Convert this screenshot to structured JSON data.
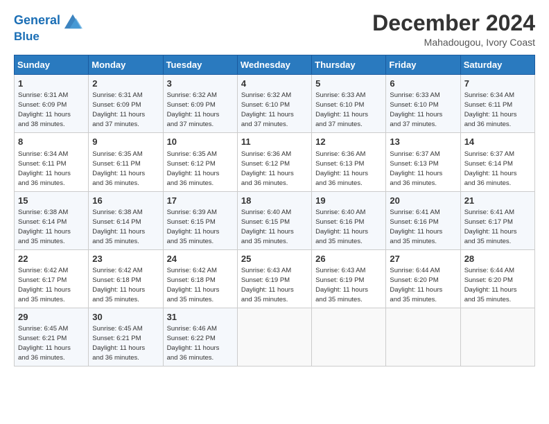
{
  "header": {
    "logo_line1": "General",
    "logo_line2": "Blue",
    "month_year": "December 2024",
    "location": "Mahadougou, Ivory Coast"
  },
  "days_of_week": [
    "Sunday",
    "Monday",
    "Tuesday",
    "Wednesday",
    "Thursday",
    "Friday",
    "Saturday"
  ],
  "weeks": [
    [
      {
        "day": "1",
        "sunrise": "6:31 AM",
        "sunset": "6:09 PM",
        "daylight": "11 hours and 38 minutes."
      },
      {
        "day": "2",
        "sunrise": "6:31 AM",
        "sunset": "6:09 PM",
        "daylight": "11 hours and 37 minutes."
      },
      {
        "day": "3",
        "sunrise": "6:32 AM",
        "sunset": "6:09 PM",
        "daylight": "11 hours and 37 minutes."
      },
      {
        "day": "4",
        "sunrise": "6:32 AM",
        "sunset": "6:10 PM",
        "daylight": "11 hours and 37 minutes."
      },
      {
        "day": "5",
        "sunrise": "6:33 AM",
        "sunset": "6:10 PM",
        "daylight": "11 hours and 37 minutes."
      },
      {
        "day": "6",
        "sunrise": "6:33 AM",
        "sunset": "6:10 PM",
        "daylight": "11 hours and 37 minutes."
      },
      {
        "day": "7",
        "sunrise": "6:34 AM",
        "sunset": "6:11 PM",
        "daylight": "11 hours and 36 minutes."
      }
    ],
    [
      {
        "day": "8",
        "sunrise": "6:34 AM",
        "sunset": "6:11 PM",
        "daylight": "11 hours and 36 minutes."
      },
      {
        "day": "9",
        "sunrise": "6:35 AM",
        "sunset": "6:11 PM",
        "daylight": "11 hours and 36 minutes."
      },
      {
        "day": "10",
        "sunrise": "6:35 AM",
        "sunset": "6:12 PM",
        "daylight": "11 hours and 36 minutes."
      },
      {
        "day": "11",
        "sunrise": "6:36 AM",
        "sunset": "6:12 PM",
        "daylight": "11 hours and 36 minutes."
      },
      {
        "day": "12",
        "sunrise": "6:36 AM",
        "sunset": "6:13 PM",
        "daylight": "11 hours and 36 minutes."
      },
      {
        "day": "13",
        "sunrise": "6:37 AM",
        "sunset": "6:13 PM",
        "daylight": "11 hours and 36 minutes."
      },
      {
        "day": "14",
        "sunrise": "6:37 AM",
        "sunset": "6:14 PM",
        "daylight": "11 hours and 36 minutes."
      }
    ],
    [
      {
        "day": "15",
        "sunrise": "6:38 AM",
        "sunset": "6:14 PM",
        "daylight": "11 hours and 35 minutes."
      },
      {
        "day": "16",
        "sunrise": "6:38 AM",
        "sunset": "6:14 PM",
        "daylight": "11 hours and 35 minutes."
      },
      {
        "day": "17",
        "sunrise": "6:39 AM",
        "sunset": "6:15 PM",
        "daylight": "11 hours and 35 minutes."
      },
      {
        "day": "18",
        "sunrise": "6:40 AM",
        "sunset": "6:15 PM",
        "daylight": "11 hours and 35 minutes."
      },
      {
        "day": "19",
        "sunrise": "6:40 AM",
        "sunset": "6:16 PM",
        "daylight": "11 hours and 35 minutes."
      },
      {
        "day": "20",
        "sunrise": "6:41 AM",
        "sunset": "6:16 PM",
        "daylight": "11 hours and 35 minutes."
      },
      {
        "day": "21",
        "sunrise": "6:41 AM",
        "sunset": "6:17 PM",
        "daylight": "11 hours and 35 minutes."
      }
    ],
    [
      {
        "day": "22",
        "sunrise": "6:42 AM",
        "sunset": "6:17 PM",
        "daylight": "11 hours and 35 minutes."
      },
      {
        "day": "23",
        "sunrise": "6:42 AM",
        "sunset": "6:18 PM",
        "daylight": "11 hours and 35 minutes."
      },
      {
        "day": "24",
        "sunrise": "6:42 AM",
        "sunset": "6:18 PM",
        "daylight": "11 hours and 35 minutes."
      },
      {
        "day": "25",
        "sunrise": "6:43 AM",
        "sunset": "6:19 PM",
        "daylight": "11 hours and 35 minutes."
      },
      {
        "day": "26",
        "sunrise": "6:43 AM",
        "sunset": "6:19 PM",
        "daylight": "11 hours and 35 minutes."
      },
      {
        "day": "27",
        "sunrise": "6:44 AM",
        "sunset": "6:20 PM",
        "daylight": "11 hours and 35 minutes."
      },
      {
        "day": "28",
        "sunrise": "6:44 AM",
        "sunset": "6:20 PM",
        "daylight": "11 hours and 35 minutes."
      }
    ],
    [
      {
        "day": "29",
        "sunrise": "6:45 AM",
        "sunset": "6:21 PM",
        "daylight": "11 hours and 36 minutes."
      },
      {
        "day": "30",
        "sunrise": "6:45 AM",
        "sunset": "6:21 PM",
        "daylight": "11 hours and 36 minutes."
      },
      {
        "day": "31",
        "sunrise": "6:46 AM",
        "sunset": "6:22 PM",
        "daylight": "11 hours and 36 minutes."
      },
      null,
      null,
      null,
      null
    ]
  ]
}
